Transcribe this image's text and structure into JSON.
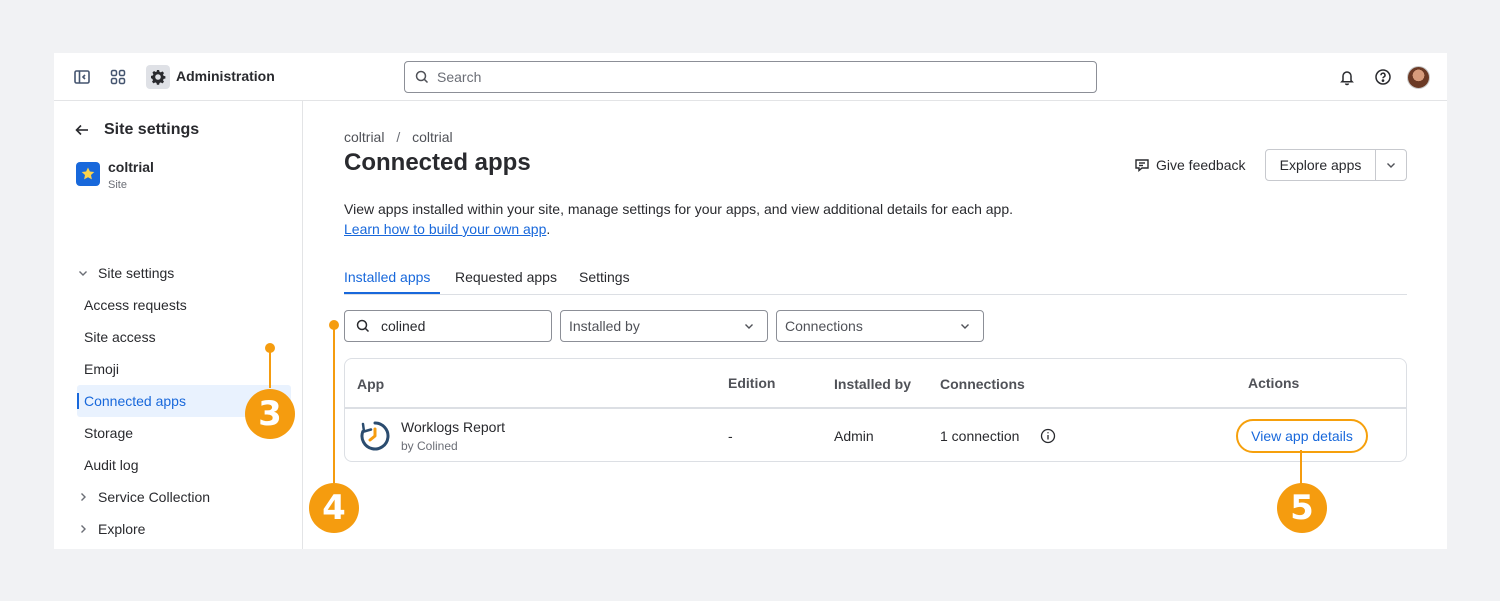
{
  "topbar": {
    "title": "Administration",
    "search_placeholder": "Search",
    "icons": [
      "sidebar-toggle-icon",
      "app-switcher-icon",
      "gear-icon",
      "bell-icon",
      "help-icon"
    ]
  },
  "sidebar": {
    "back_label": "Site settings",
    "site_name": "coltrial",
    "site_type": "Site",
    "group_label": "Site settings",
    "items": [
      "Access requests",
      "Site access",
      "Emoji",
      "Connected apps",
      "Storage",
      "Audit log"
    ],
    "active_item": "Connected apps",
    "collapsed_groups": [
      "Service Collection",
      "Explore"
    ]
  },
  "main": {
    "breadcrumb": [
      "coltrial",
      "coltrial"
    ],
    "breadcrumb_sep": "/",
    "title": "Connected apps",
    "feedback_label": "Give feedback",
    "explore_label": "Explore apps",
    "description": "View apps installed within your site, manage settings for your apps, and view additional details for each app.",
    "learn_link": "Learn how to build your own app",
    "learn_suffix": ".",
    "tabs": [
      "Installed apps",
      "Requested apps",
      "Settings"
    ],
    "active_tab": "Installed apps",
    "filters": {
      "search_value": "colined",
      "installed_by_placeholder": "Installed by",
      "connections_placeholder": "Connections"
    },
    "table": {
      "headers": [
        "App",
        "Edition",
        "Installed by",
        "Connections",
        "Actions"
      ],
      "rows": [
        {
          "app_name": "Worklogs Report",
          "vendor": "by Colined",
          "edition": "-",
          "installed_by": "Admin",
          "connections": "1 connection",
          "action": "View app details"
        }
      ]
    }
  },
  "callouts": [
    "3",
    "4",
    "5"
  ],
  "colors": {
    "accent": "#1868db",
    "callout": "#f59c0f",
    "active_bg": "#e9f2fe"
  }
}
